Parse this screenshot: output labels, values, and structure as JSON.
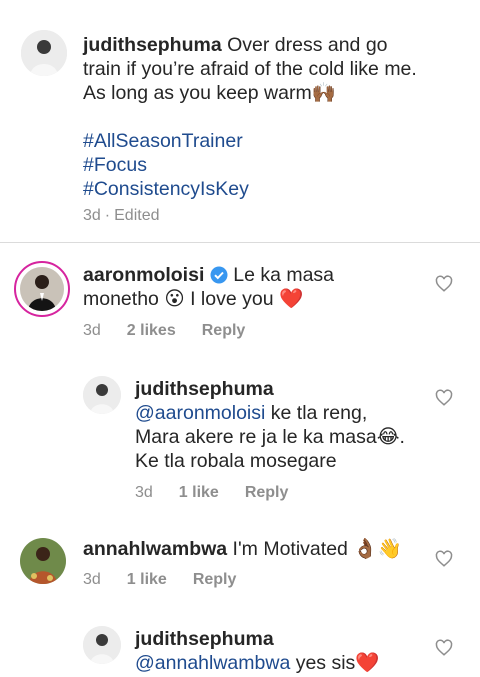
{
  "comments": [
    {
      "username": "judithsephuma",
      "text": " Over dress and go train if you’re afraid of the cold like me. As long as you keep warm",
      "emoji": "🙌🏾",
      "hashtags": [
        "#AllSeasonTrainer",
        "#Focus",
        "#ConsistencyIsKey"
      ],
      "time": "3d",
      "edited": "Edited"
    },
    {
      "username": "aaronmoloisi",
      "text_a": "Le ka masa monetho ",
      "emoji_a": "😮",
      "text_b": " I love you ",
      "emoji_b": "❤️",
      "time": "3d",
      "likes": "2 likes",
      "reply": "Reply"
    },
    {
      "username": "judithsephuma",
      "mention": "@aaronmoloisi",
      "text_a": " ke tla reng, Mara akere re ja le ka masa",
      "emoji_a": "😂",
      "text_b": ". Ke tla robala mosegare",
      "time": "3d",
      "likes": "1 like",
      "reply": "Reply"
    },
    {
      "username": "annahlwambwa",
      "text": " I'm Motivated ",
      "emoji": "👌🏾👋",
      "time": "3d",
      "likes": "1 like",
      "reply": "Reply"
    },
    {
      "username": "judithsephuma",
      "mention": "@annahlwambwa",
      "text": " yes sis",
      "emoji": "❤️"
    }
  ],
  "icons": {
    "like": "heart-outline-icon",
    "verified": "verified-badge-icon"
  }
}
